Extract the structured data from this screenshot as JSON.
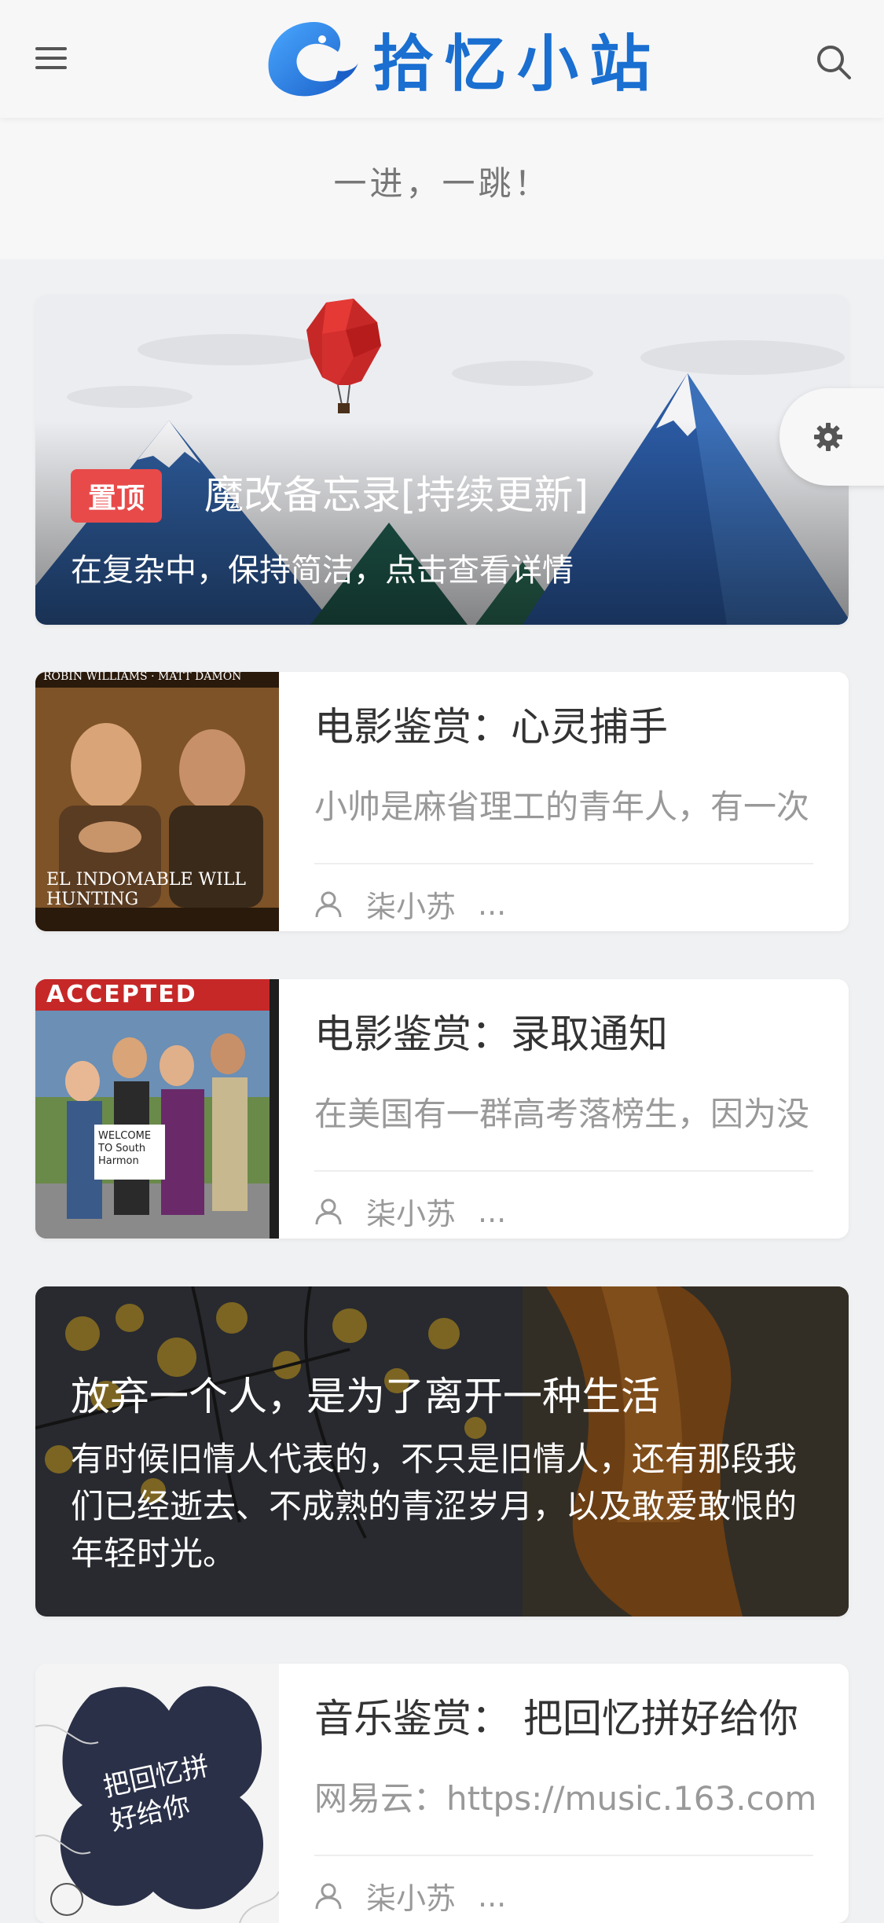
{
  "header": {
    "site_name": "拾忆小站",
    "menu_icon": "hamburger-icon",
    "search_icon": "search-icon"
  },
  "slogan": "一进，一跳！",
  "hero": {
    "badge": "置顶",
    "title": "魔改备忘录[持续更新]",
    "subtitle": "在复杂中，保持简洁，点击查看详情"
  },
  "settings_icon": "gear-icon",
  "posts": [
    {
      "title": "电影鉴赏：心灵捕手",
      "excerpt": "小帅是麻省理工的青年人，有一次",
      "author": "柒小苏",
      "more": "...",
      "thumb_text": "EL INDOMABLE WILL HUNTING",
      "thumb_top": "ROBIN WILLIAMS  ·  MATT DAMON"
    },
    {
      "title": "电影鉴赏：录取通知",
      "excerpt": "在美国有一群高考落榜生，因为没",
      "author": "柒小苏",
      "more": "...",
      "thumb_text": "ACCEPTED",
      "thumb_sign": "WELCOME TO South Harmon"
    },
    {
      "title": "音乐鉴赏： 把回忆拼好给你",
      "excerpt": "网易云：https://music.163.com",
      "author": "柒小苏",
      "more": "...",
      "thumb_text": "把回忆拼好给你"
    }
  ],
  "wide_post": {
    "title": "放弃一个人，是为了离开一种生活",
    "description": "有时候旧情人代表的，不只是旧情人，还有那段我们已经逝去、不成熟的青涩岁月，以及敢爱敢恨的年轻时光。"
  },
  "colors": {
    "brand": "#1a6fd0",
    "badge": "#e84a4a",
    "background": "#f0f1f3"
  }
}
